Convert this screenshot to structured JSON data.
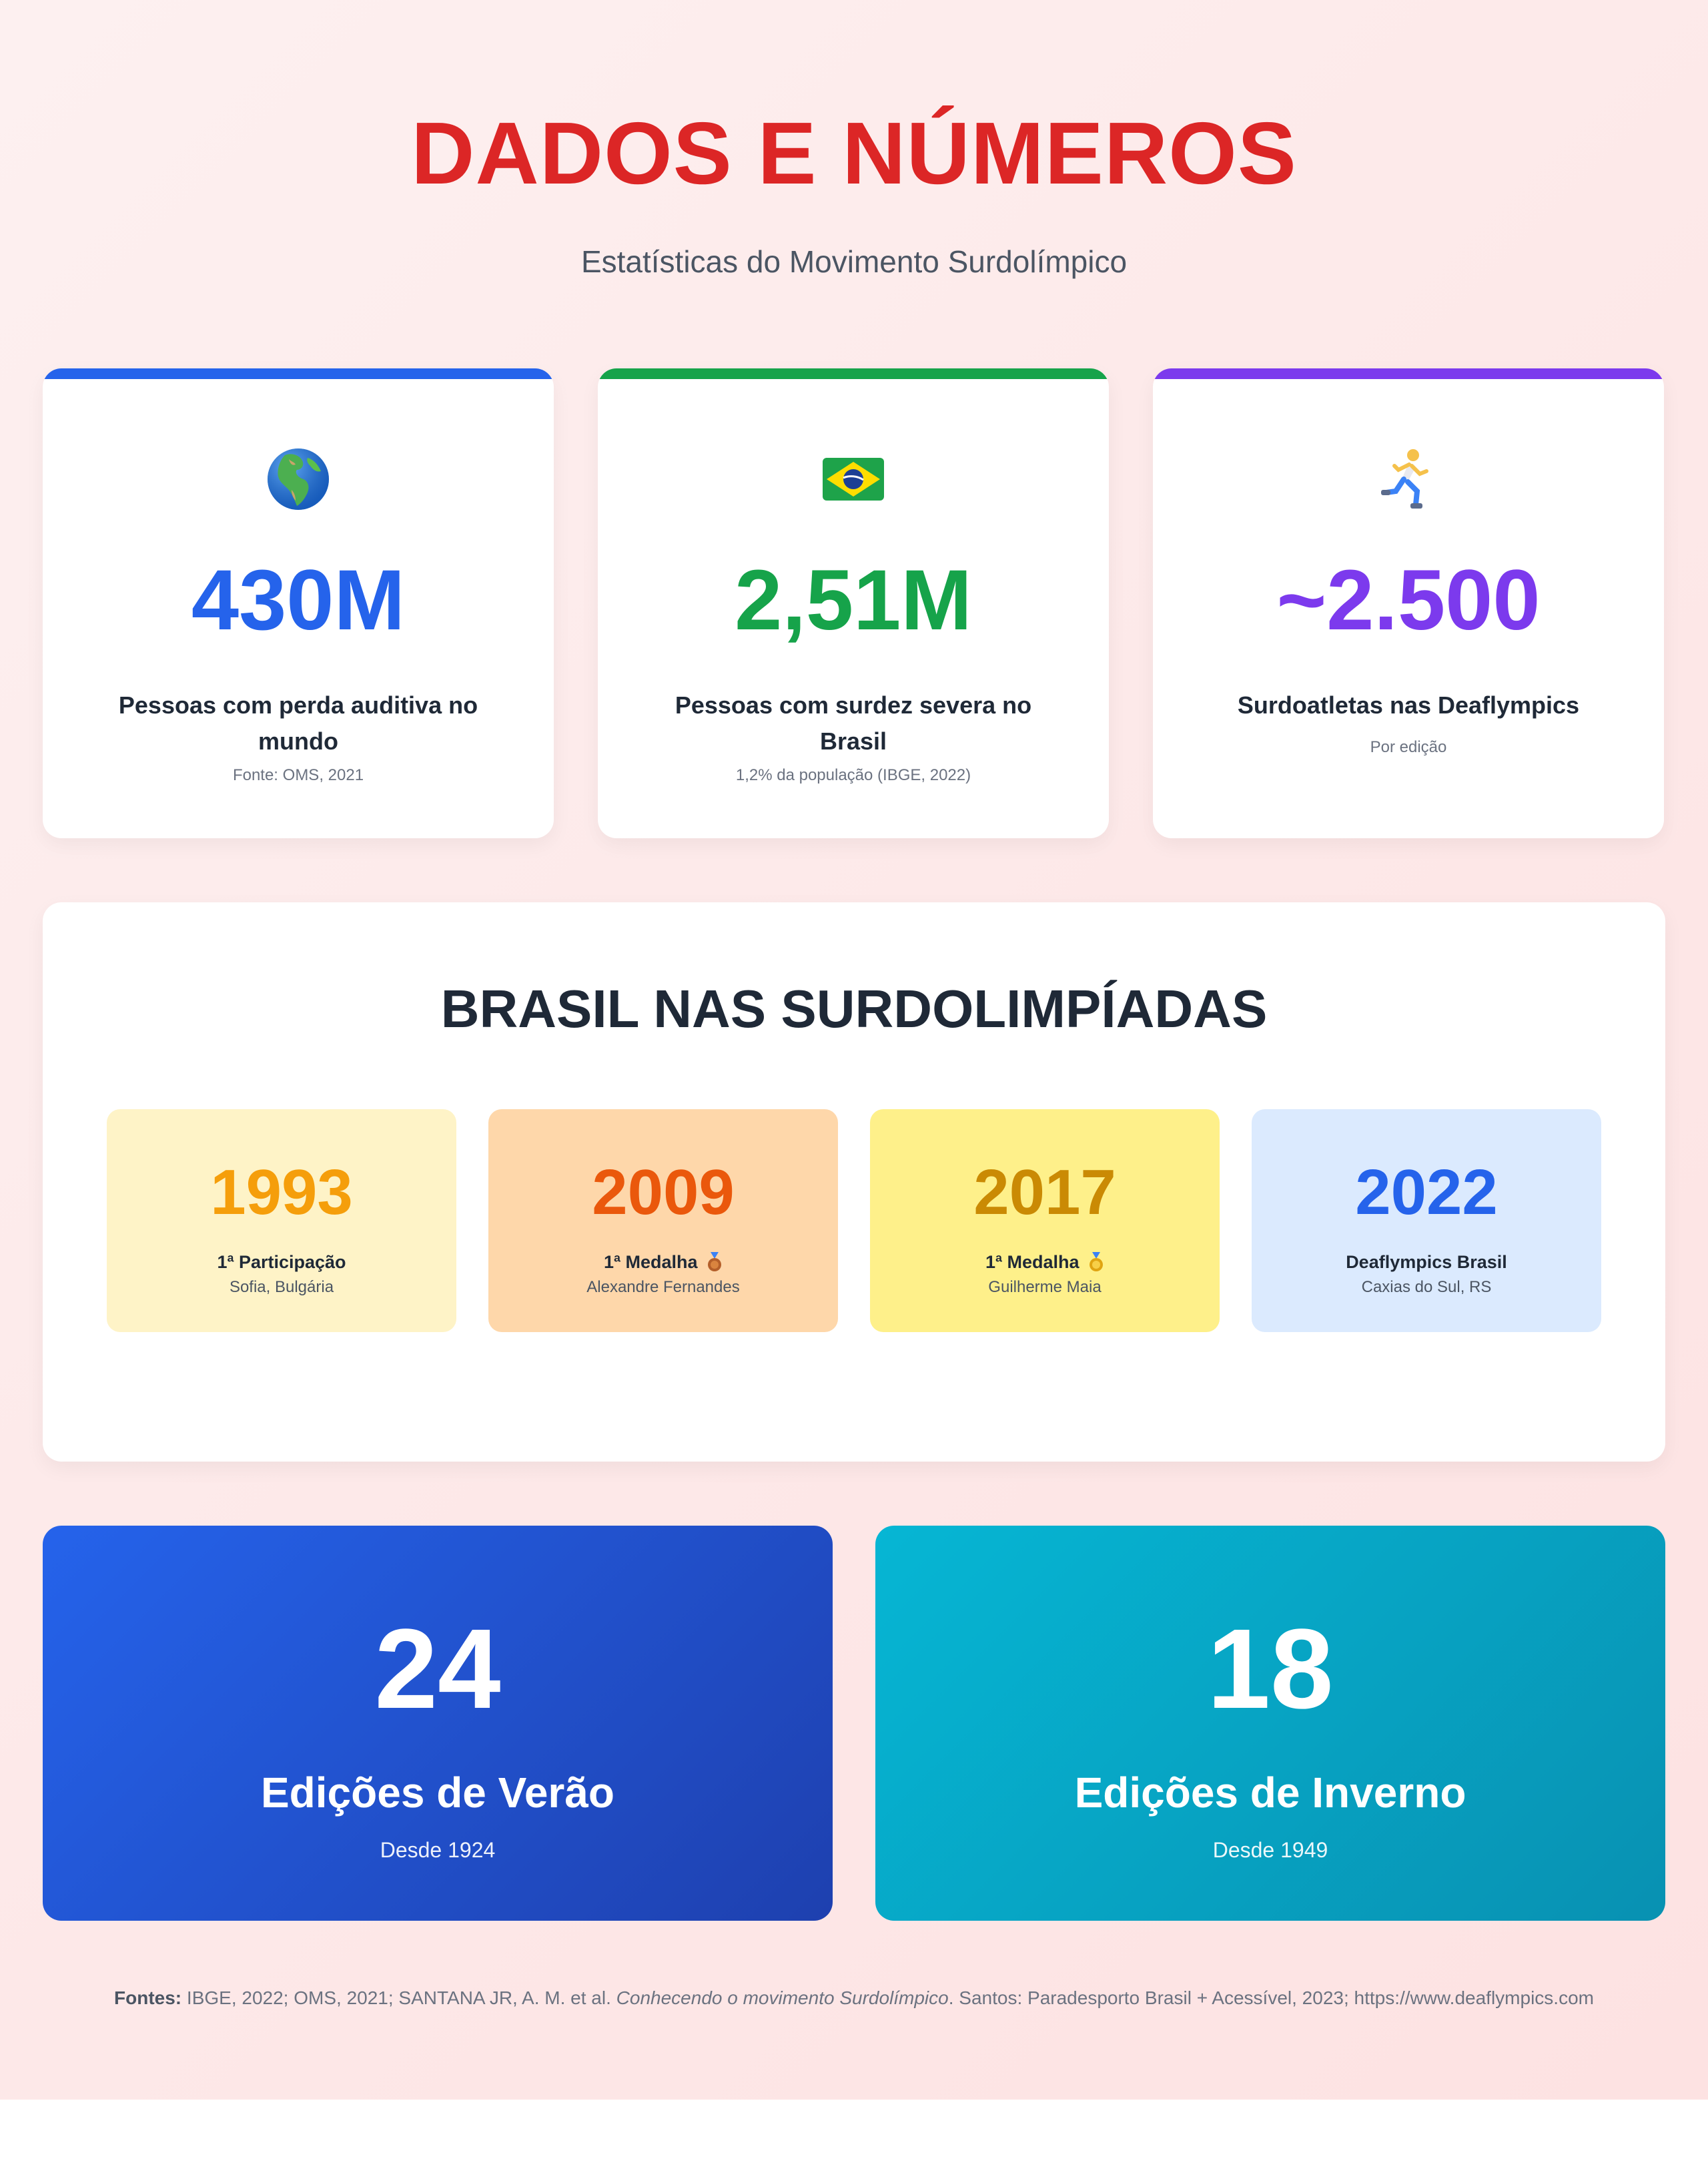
{
  "header": {
    "title": "DADOS E NÚMEROS",
    "subtitle": "Estatísticas do Movimento Surdolímpico"
  },
  "stats": [
    {
      "icon": "globe-icon",
      "value": "430M",
      "label": "Pessoas com perda auditiva no mundo",
      "source": "Fonte: OMS, 2021",
      "color": "#2563eb"
    },
    {
      "icon": "brazil-flag-icon",
      "value": "2,51M",
      "label": "Pessoas com surdez severa no Brasil",
      "source": "1,2% da população (IBGE, 2022)",
      "color": "#16a34a"
    },
    {
      "icon": "runner-icon",
      "value": "~2.500",
      "label": "Surdoatletas nas Deaflympics",
      "source": "Por edição",
      "color": "#7c3aed"
    }
  ],
  "timeline": {
    "title": "BRASIL NAS SURDOLIMPÍADAS",
    "items": [
      {
        "year": "1993",
        "event": "1ª Participação",
        "medal_icon": "",
        "place": "Sofia, Bulgária",
        "color": "#f59e0b",
        "bg": "#fef3c7"
      },
      {
        "year": "2009",
        "event": "1ª Medalha",
        "medal_icon": "bronze-medal-icon",
        "place": "Alexandre Fernandes",
        "color": "#ea580c",
        "bg": "#fed7aa"
      },
      {
        "year": "2017",
        "event": "1ª Medalha",
        "medal_icon": "gold-medal-icon",
        "place": "Guilherme Maia",
        "color": "#ca8a04",
        "bg": "#fef08a"
      },
      {
        "year": "2022",
        "event": "Deaflympics Brasil",
        "medal_icon": "",
        "place": "Caxias do Sul, RS",
        "color": "#2563eb",
        "bg": "#dbeafe"
      }
    ]
  },
  "editions": [
    {
      "value": "24",
      "title": "Edições de Verão",
      "since": "Desde 1924"
    },
    {
      "value": "18",
      "title": "Edições de Inverno",
      "since": "Desde 1949"
    }
  ],
  "footer": {
    "label": "Fontes:",
    "text1": " IBGE, 2022; OMS, 2021; SANTANA JR, A. M. et al. ",
    "italic": "Conhecendo o movimento Surdolímpico",
    "text2": ". Santos: Paradesporto Brasil + Acessível, 2023; https://www.deaflympics.com"
  }
}
